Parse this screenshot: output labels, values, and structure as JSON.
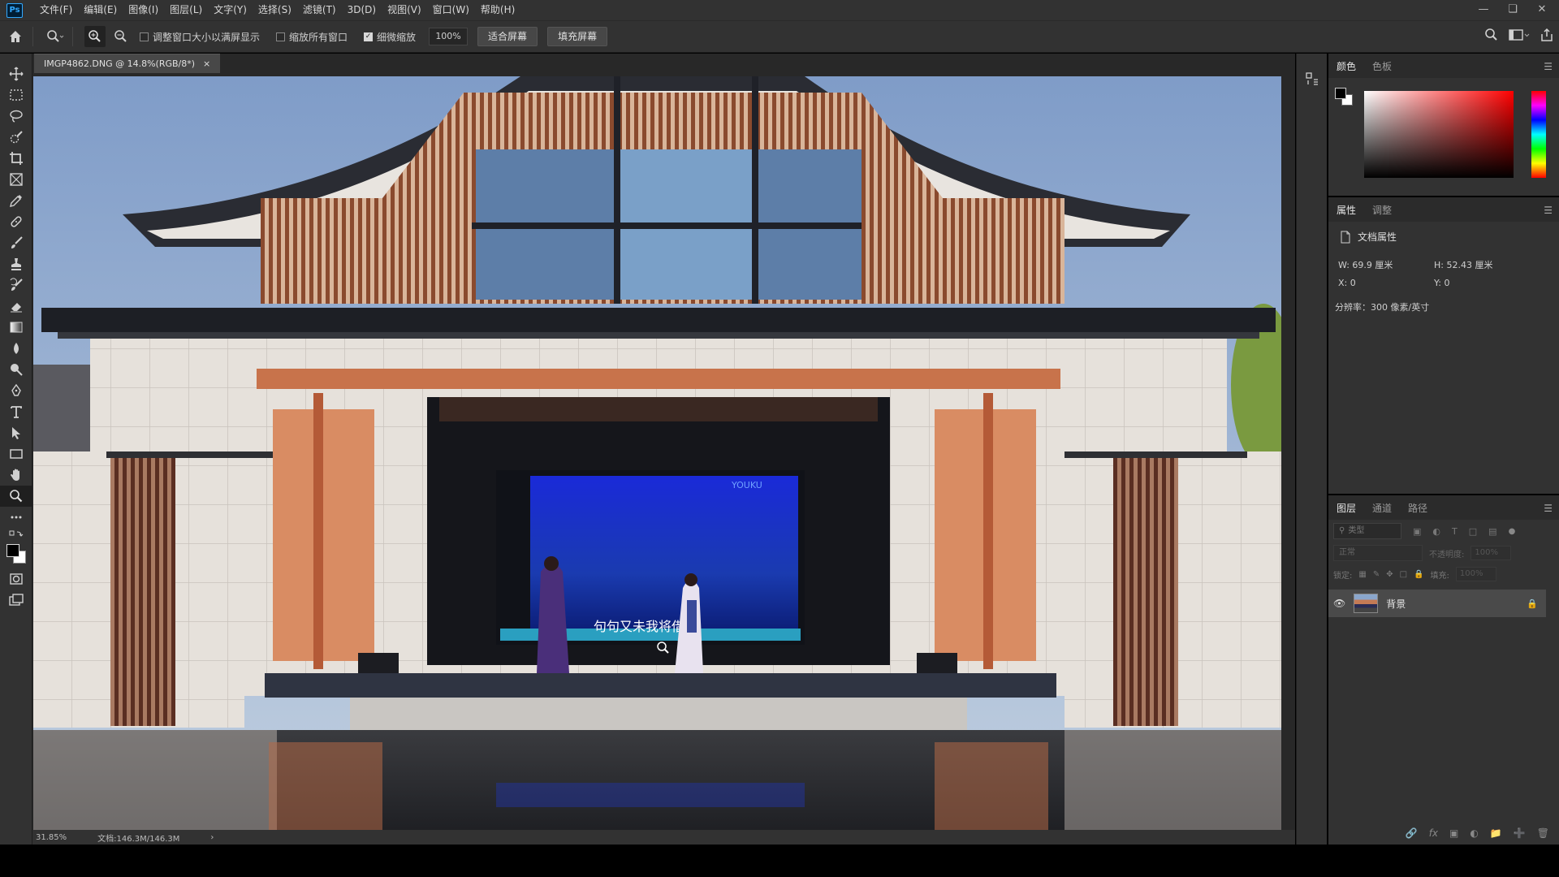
{
  "app": {
    "logo": "Ps",
    "menu": [
      "文件(F)",
      "编辑(E)",
      "图像(I)",
      "图层(L)",
      "文字(Y)",
      "选择(S)",
      "滤镜(T)",
      "3D(D)",
      "视图(V)",
      "窗口(W)",
      "帮助(H)"
    ]
  },
  "options": {
    "resize_windows": "调整窗口大小以满屏显示",
    "zoom_all": "缩放所有窗口",
    "scrubby_zoom": "细微缩放",
    "zoom_value": "100%",
    "fit_screen": "适合屏幕",
    "fill_screen": "填充屏幕",
    "resize_windows_checked": false,
    "zoom_all_checked": false,
    "scrubby_zoom_checked": true
  },
  "document": {
    "tab_title": "IMGP4862.DNG @ 14.8%(RGB/8*)",
    "close": "×"
  },
  "status": {
    "zoom": "31.85%",
    "doc": "文档:146.3M/146.3M",
    "arrow": "›"
  },
  "color_panel": {
    "tabs": [
      "颜色",
      "色板"
    ],
    "fg": "#000000",
    "bg": "#ffffff",
    "hue": "#ff0000"
  },
  "properties_panel": {
    "tabs": [
      "属性",
      "调整"
    ],
    "title": "文档属性",
    "w": "W:  69.9 厘米",
    "h": "H:  52.43 厘米",
    "x": "X:  0",
    "y": "Y:  0",
    "resolution": "分辨率：300 像素/英寸"
  },
  "layers_panel": {
    "tabs": [
      "图层",
      "通道",
      "路径"
    ],
    "search": "类型",
    "blend": "正常",
    "opacity_label": "不透明度:",
    "opacity": "100%",
    "lock_label": "锁定:",
    "fill_label": "填充:",
    "fill": "100%",
    "layer_name": "背景"
  },
  "scene": {
    "screen_brand": "YOUKU",
    "subtitle": "句句又未我将借达"
  }
}
